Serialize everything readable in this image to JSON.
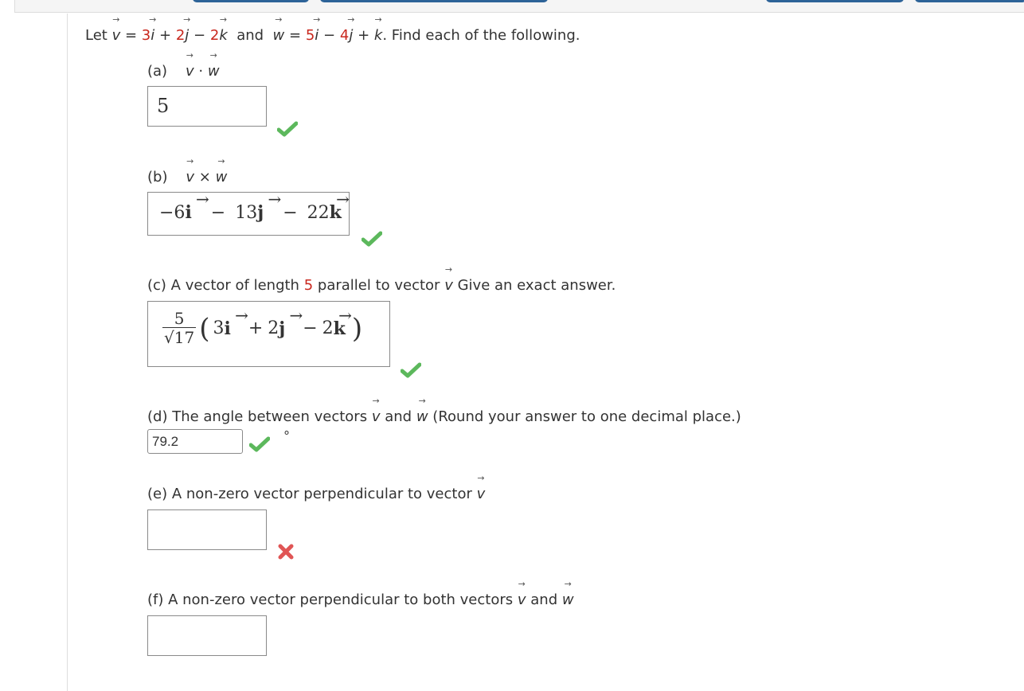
{
  "header": {
    "buttons": [
      {
        "name": "toolbar-button-1"
      },
      {
        "name": "toolbar-button-2"
      },
      {
        "name": "toolbar-button-3"
      },
      {
        "name": "toolbar-button-4"
      }
    ]
  },
  "colors": {
    "accent_blue": "#2d6398",
    "given_value_red": "#c9271d",
    "correct_green": "#5cb85c",
    "incorrect_red": "#e05555"
  },
  "intro": {
    "let": "Let",
    "v": "v",
    "eq": "=",
    "v_i_coef": "3",
    "i": "i",
    "plus1": "+",
    "v_j_coef": "2",
    "j": "j",
    "minus1": "−",
    "v_k_coef": "2",
    "k": "k",
    "and": "and",
    "w": "w",
    "w_i_coef": "5",
    "minus2": "−",
    "w_j_coef": "4",
    "plus2": "+",
    "end": ". Find each of the following."
  },
  "parts": {
    "a": {
      "label": "(a)",
      "expr_v": "v",
      "expr_op": "·",
      "expr_w": "w",
      "answer": "5",
      "status": "correct"
    },
    "b": {
      "label": "(b)",
      "expr_v": "v",
      "expr_op": "×",
      "expr_w": "w",
      "answer": {
        "i_coef": "−6",
        "i": "i",
        "op1": "−",
        "j_coef": "13",
        "j": "j",
        "op2": "−",
        "k_coef": "22",
        "k": "k"
      },
      "status": "correct"
    },
    "c": {
      "prefix": "(c) A vector of length",
      "length": "5",
      "middle": "parallel to vector",
      "v": "v",
      "suffix": "Give an exact answer.",
      "answer": {
        "numerator": "5",
        "sqrt": "√",
        "denominator": "17",
        "lparen": "(",
        "i_coef": "3",
        "i": "i",
        "op1": "+",
        "j_coef": "2",
        "j": "j",
        "op2": "−",
        "k_coef": "2",
        "k": "k",
        "rparen": ")"
      },
      "status": "correct"
    },
    "d": {
      "prefix": "(d) The angle between vectors",
      "v": "v",
      "and": "and",
      "w": "w",
      "suffix": "(Round your answer to one decimal place.)",
      "answer": "79.2",
      "unit": "°",
      "status": "correct"
    },
    "e": {
      "prefix": "(e) A non-zero vector perpendicular to vector",
      "v": "v",
      "answer": "",
      "status": "incorrect"
    },
    "f": {
      "prefix": "(f) A non-zero vector perpendicular to both vectors",
      "v": "v",
      "and": "and",
      "w": "w",
      "answer": ""
    }
  }
}
